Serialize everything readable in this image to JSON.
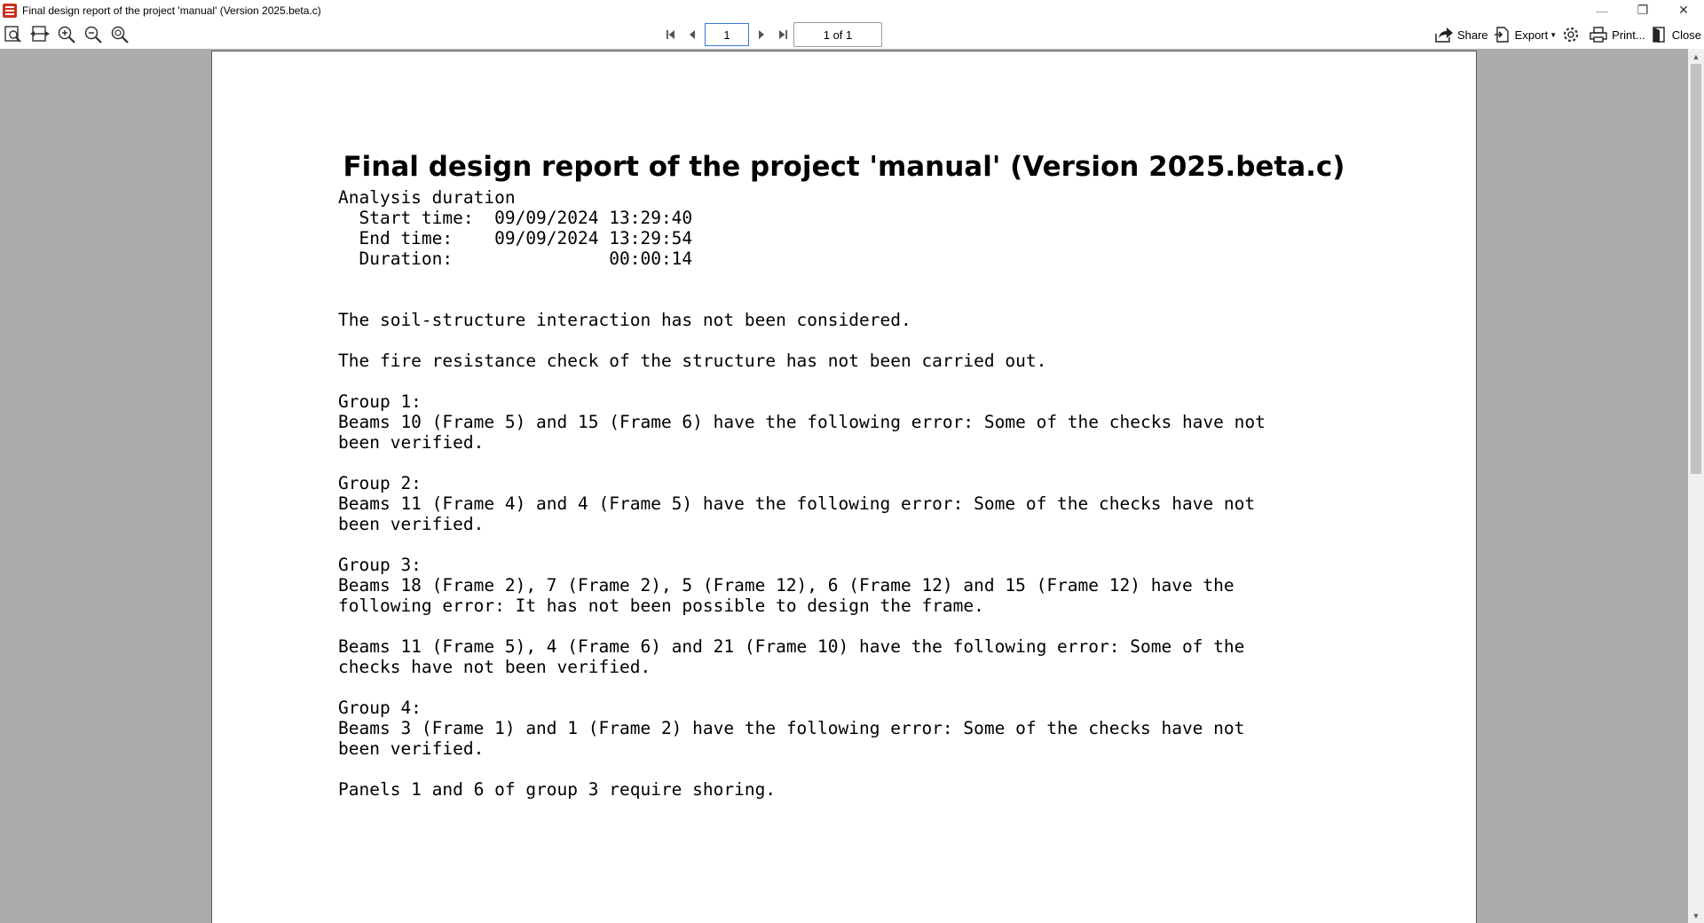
{
  "window": {
    "title": "Final design report of the project 'manual' (Version 2025.beta.c)",
    "minimize": "—",
    "restore": "❐",
    "close": "✕"
  },
  "toolbar": {
    "left_icons": [
      "fit-page-icon",
      "fit-width-icon",
      "zoom-in-icon",
      "zoom-out-icon",
      "zoom-custom-icon"
    ],
    "page_input_value": "1",
    "page_count": "1 of 1",
    "share_label": "Share",
    "export_label": "Export",
    "print_label": "Print...",
    "close_label": "Close"
  },
  "report": {
    "title": "Final design report of the project 'manual' (Version 2025.beta.c)",
    "lines": [
      "Analysis duration",
      "  Start time:  09/09/2024 13:29:40",
      "  End time:    09/09/2024 13:29:54",
      "  Duration:               00:00:14",
      "",
      "",
      "The soil-structure interaction has not been considered.",
      "",
      "The fire resistance check of the structure has not been carried out.",
      "",
      "Group 1:",
      "Beams 10 (Frame 5) and 15 (Frame 6) have the following error: Some of the checks have not",
      "been verified.",
      "",
      "Group 2:",
      "Beams 11 (Frame 4) and 4 (Frame 5) have the following error: Some of the checks have not",
      "been verified.",
      "",
      "Group 3:",
      "Beams 18 (Frame 2), 7 (Frame 2), 5 (Frame 12), 6 (Frame 12) and 15 (Frame 12) have the",
      "following error: It has not been possible to design the frame.",
      "",
      "Beams 11 (Frame 5), 4 (Frame 6) and 21 (Frame 10) have the following error: Some of the",
      "checks have not been verified.",
      "",
      "Group 4:",
      "Beams 3 (Frame 1) and 1 (Frame 2) have the following error: Some of the checks have not",
      "been verified.",
      "",
      "Panels 1 and 6 of group 3 require shoring."
    ]
  }
}
